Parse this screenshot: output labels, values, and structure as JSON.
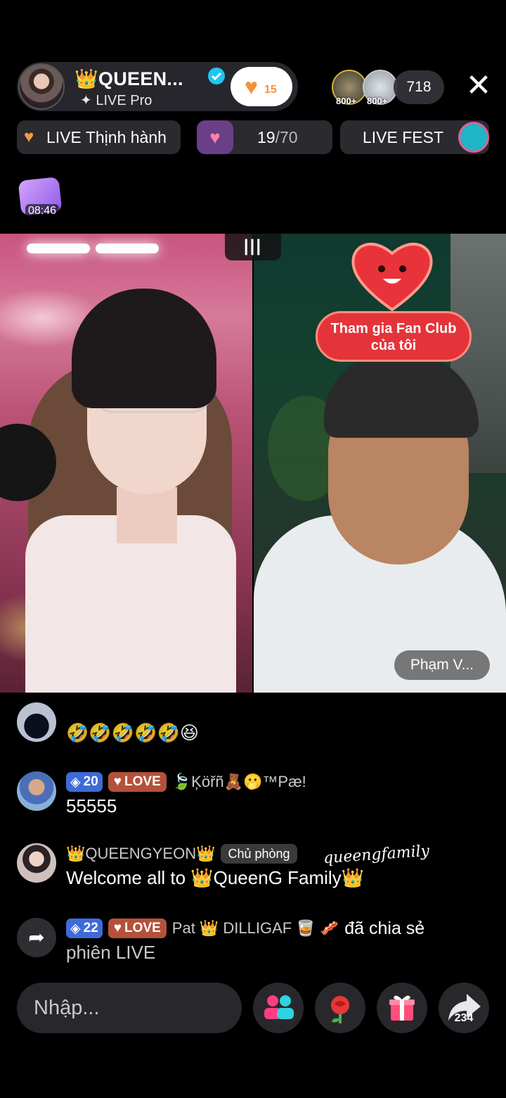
{
  "host": {
    "name": "👑QUEEN...",
    "subtitle": "✦ LIVE Pro",
    "fan_level": "15"
  },
  "viewers": {
    "top_badges": [
      "800+",
      "800+"
    ],
    "count": "718"
  },
  "chips": {
    "trending": "LIVE Thịnh hành",
    "progress_current": "19",
    "progress_total": "/70",
    "fest": "LIVE FEST"
  },
  "gift_timer": "08:46",
  "video": {
    "fanclub_line1": "Tham gia Fan Club",
    "fanclub_line2": "của tôi",
    "guest_name": "Phạm V..."
  },
  "chat": [
    {
      "level": "",
      "tag": "",
      "user": "",
      "message": "🤣🤣🤣🤣🤣😆"
    },
    {
      "level": "20",
      "tag": "LOVE",
      "user": "🍃Ķöřñ🧸🫢™Pæ!",
      "message": "55555"
    },
    {
      "user": "👑QUEENGYEON👑",
      "host_label": "Chủ phòng",
      "script": "queengfamily",
      "message": "Welcome all to 👑QueenG Family👑"
    },
    {
      "level": "22",
      "tag": "LOVE",
      "user": "Pat 👑 DILLIGAF 🥃 🥓",
      "action": "đã chia sẻ",
      "message": "phiên LIVE"
    }
  ],
  "bottom": {
    "input_placeholder": "Nhập...",
    "share_count": "234"
  },
  "colors": {
    "accent_orange": "#f3923a",
    "level_blue": "#3d6bd8",
    "love_red": "#b5513a",
    "fanclub_red": "#e4343a"
  }
}
